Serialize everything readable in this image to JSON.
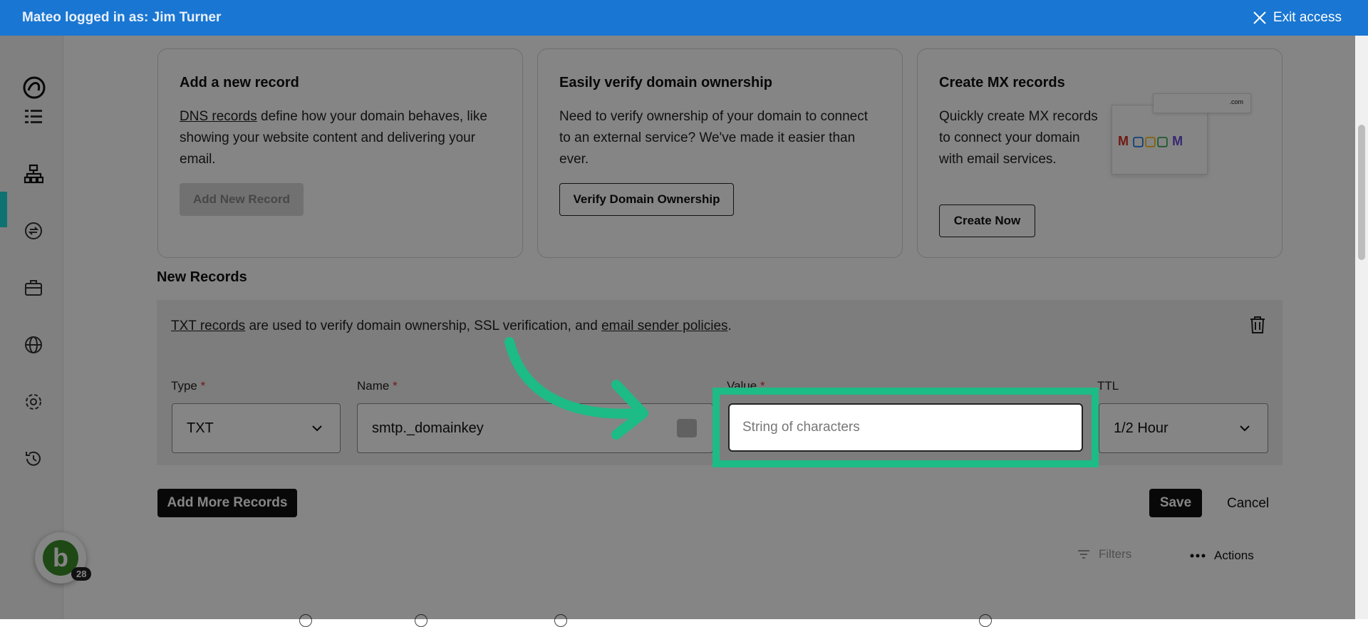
{
  "topbar": {
    "user_text": "Mateo logged in as: Jim Turner",
    "exit_label": "Exit access"
  },
  "sidebar": {
    "items": [
      {
        "icon": "list-icon"
      },
      {
        "icon": "dns-hierarchy-icon",
        "active": true
      },
      {
        "icon": "transfer-icon"
      },
      {
        "icon": "briefcase-icon"
      },
      {
        "icon": "globe-icon"
      },
      {
        "icon": "gear-icon"
      },
      {
        "icon": "history-icon"
      }
    ],
    "avatar_letter": "b",
    "avatar_badge": "28"
  },
  "cards": {
    "add_record": {
      "title": "Add a new record",
      "link_text": "DNS records",
      "text_after_link": " define how your domain behaves, like showing your website content and delivering your email.",
      "button_label": "Add New Record"
    },
    "verify": {
      "title": "Easily verify domain ownership",
      "text": "Need to verify ownership of your domain to connect to an external service? We've made it easier than ever.",
      "button_label": "Verify Domain Ownership"
    },
    "mx": {
      "title": "Create MX records",
      "text": "Quickly create MX records to connect your domain with email services.",
      "button_label": "Create Now",
      "illustration_text": ".com"
    }
  },
  "new_records": {
    "title": "New Records",
    "desc_link1": "TXT records",
    "desc_middle": " are used to verify domain ownership, SSL verification, and ",
    "desc_link2": "email sender policies",
    "desc_end": ".",
    "type_label": "Type",
    "type_value": "TXT",
    "name_label": "Name",
    "name_value": "smtp._domainkey",
    "value_label": "Value",
    "value_placeholder": "String of characters",
    "ttl_label": "TTL",
    "ttl_value": "1/2 Hour",
    "required_mark": "*"
  },
  "actions": {
    "add_more": "Add More Records",
    "save": "Save",
    "cancel": "Cancel",
    "filters": "Filters",
    "actions": "Actions"
  },
  "colors": {
    "topbar": "#1976d2",
    "highlight": "#1dbb86",
    "sidebar_active": "#1bdbdb"
  }
}
